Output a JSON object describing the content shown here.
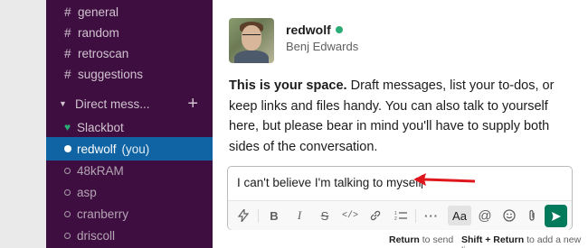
{
  "sidebar": {
    "channels": [
      {
        "label": "general"
      },
      {
        "label": "random"
      },
      {
        "label": "retroscan"
      },
      {
        "label": "suggestions"
      }
    ],
    "dm_section_label": "Direct mess...",
    "dm_add_symbol": "+",
    "dms": [
      {
        "label": "Slackbot",
        "status": "heart"
      },
      {
        "label": "redwolf",
        "suffix": "(you)",
        "status": "online",
        "active": true
      },
      {
        "label": "48kRAM",
        "status": "offline"
      },
      {
        "label": "asp",
        "status": "offline"
      },
      {
        "label": "cranberry",
        "status": "offline"
      },
      {
        "label": "driscoll",
        "status": "offline"
      }
    ]
  },
  "profile": {
    "username": "redwolf",
    "real_name": "Benj Edwards",
    "status_color": "#2bac76"
  },
  "intro": {
    "bold": "This is your space.",
    "text": " Draft messages, list your to-dos, or keep links and files handy. You can also talk to yourself here, but please bear in mind you'll have to supply both sides of the conversation."
  },
  "composer": {
    "value": "I can't believe I'm talking to myself",
    "toolbar_icons": [
      "lightning-icon",
      "bold-icon",
      "italic-icon",
      "strikethrough-icon",
      "code-icon",
      "link-icon",
      "ordered-list-icon",
      "more-icon",
      "text-format-icon",
      "mention-icon",
      "emoji-icon",
      "attach-icon",
      "send-icon"
    ],
    "aa_label": "Aa",
    "send_color": "#007a5a"
  },
  "hints": {
    "return_key": "Return",
    "return_text": "to send",
    "shift_key": "Shift + Return",
    "shift_text": "to add a new line"
  },
  "colors": {
    "sidebar_bg": "#3f0e40",
    "active_item": "#1164a3",
    "annotation_arrow": "#e0161d"
  }
}
